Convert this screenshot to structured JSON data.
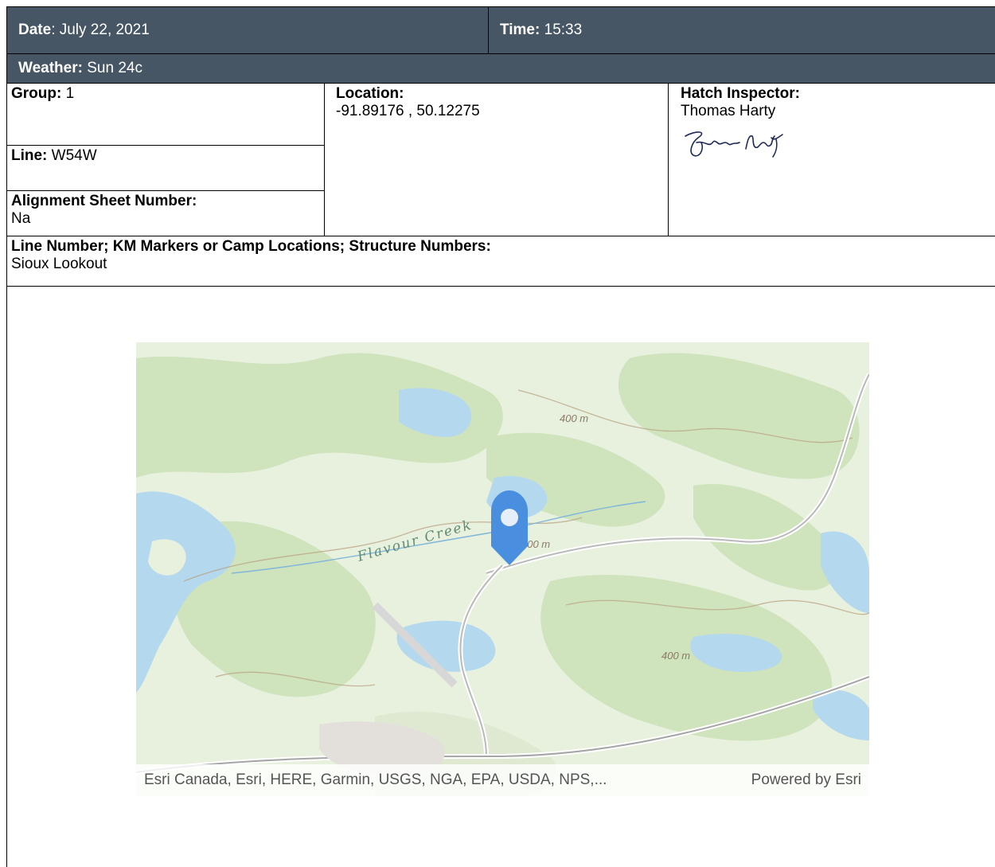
{
  "header": {
    "date_label": "Date",
    "date_value": ": July 22, 2021",
    "time_label": "Time:",
    "time_value": " 15:33",
    "weather_label": "Weather:",
    "weather_value": " Sun 24c"
  },
  "fields": {
    "group_label": "Group:",
    "group_value": " 1",
    "line_label": "Line:",
    "line_value": " W54W",
    "alignment_label": "Alignment Sheet Number:",
    "alignment_value": "Na",
    "location_label": "Location:",
    "location_value": "-91.89176 , 50.12275",
    "inspector_label": "Hatch Inspector:",
    "inspector_value": "Thomas Harty",
    "signature_text": "Thomas Harty",
    "line_number_label": "Line Number; KM Markers or Camp Locations; Structure Numbers:",
    "line_number_value": "Sioux Lookout"
  },
  "map": {
    "creek_label": "Flavour Creek",
    "elevation_labels": [
      "400 m",
      "400 m",
      "400 m"
    ],
    "attribution": "Esri Canada, Esri, HERE, Garmin, USGS, NGA, EPA, USDA, NPS,...",
    "powered_by": "Powered by Esri",
    "marker_icon": "map-pin-icon",
    "colors": {
      "land": "#e8f1de",
      "forest": "#cfe3bd",
      "water": "#b4d8ee",
      "marker": "#4a8ee0",
      "road": "#b9b9b9"
    }
  }
}
